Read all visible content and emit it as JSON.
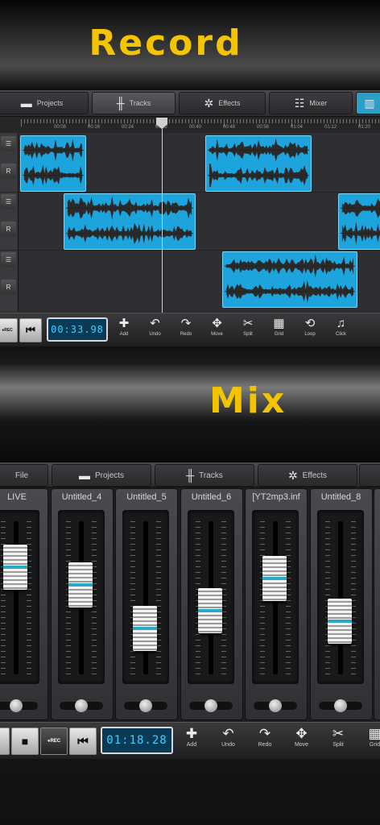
{
  "headlines": {
    "record": "Record",
    "mix": "Mix"
  },
  "record_screen": {
    "tabs": [
      {
        "label": "Projects",
        "icon": "folder-icon"
      },
      {
        "label": "Tracks",
        "icon": "waveform-icon"
      },
      {
        "label": "Effects",
        "icon": "effects-icon"
      },
      {
        "label": "Mixer",
        "icon": "mixer-icon"
      }
    ],
    "ruler_labels": [
      "00:08",
      "00:16",
      "00:24",
      "00:32",
      "00:40",
      "00:48",
      "00:56",
      "01:04",
      "01:12",
      "01:20"
    ],
    "track_buttons": {
      "menu": "☰",
      "record": "R"
    },
    "time": "00:33.98",
    "rec_label": "●REC",
    "toolbar": [
      {
        "label": "Add",
        "icon": "plus-icon",
        "glyph": "✚"
      },
      {
        "label": "Undo",
        "icon": "undo-icon",
        "glyph": "↶"
      },
      {
        "label": "Redo",
        "icon": "redo-icon",
        "glyph": "↷"
      },
      {
        "label": "Move",
        "icon": "move-icon",
        "glyph": "✥"
      },
      {
        "label": "Split",
        "icon": "scissors-icon",
        "glyph": "✂"
      },
      {
        "label": "Grid",
        "icon": "grid-icon",
        "glyph": "▦"
      },
      {
        "label": "Loop",
        "icon": "loop-icon",
        "glyph": "⟲"
      },
      {
        "label": "Click",
        "icon": "metronome-icon",
        "glyph": "♫"
      }
    ]
  },
  "mix_screen": {
    "tabs": [
      {
        "label": "File",
        "icon": ""
      },
      {
        "label": "Projects",
        "icon": "folder-icon"
      },
      {
        "label": "Tracks",
        "icon": "waveform-icon"
      },
      {
        "label": "Effects",
        "icon": "effects-icon"
      }
    ],
    "channels": [
      {
        "name": "LIVE",
        "level": 0.78
      },
      {
        "name": "Untitled_4",
        "level": 0.62
      },
      {
        "name": "Untitled_5",
        "level": 0.22
      },
      {
        "name": "Untitled_6",
        "level": 0.38
      },
      {
        "name": "[YT2mp3.inf",
        "level": 0.68
      },
      {
        "name": "Untitled_8",
        "level": 0.28
      }
    ],
    "time": "01:18.28",
    "rec_label": "●REC",
    "toolbar": [
      {
        "label": "Add",
        "icon": "plus-icon",
        "glyph": "✚"
      },
      {
        "label": "Undo",
        "icon": "undo-icon",
        "glyph": "↶"
      },
      {
        "label": "Redo",
        "icon": "redo-icon",
        "glyph": "↷"
      },
      {
        "label": "Move",
        "icon": "move-icon",
        "glyph": "✥"
      },
      {
        "label": "Split",
        "icon": "scissors-icon",
        "glyph": "✂"
      },
      {
        "label": "Grid",
        "icon": "grid-icon",
        "glyph": "▦"
      }
    ]
  },
  "colors": {
    "headline": "#f5c400",
    "clip": "#1ea4dc",
    "lcd_text": "#3fd0ff",
    "fader_mark": "#27a9c9"
  }
}
